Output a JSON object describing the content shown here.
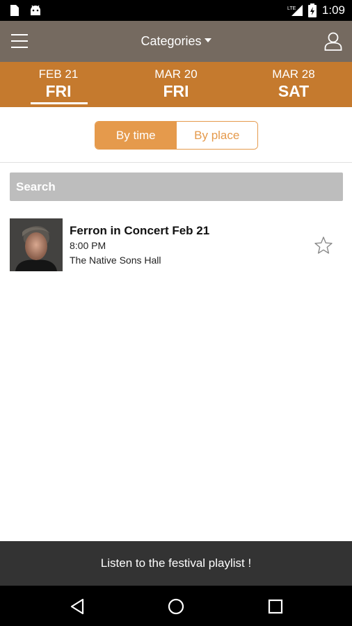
{
  "status_bar": {
    "network": "LTE",
    "time": "1:09",
    "icons": [
      "sim-card-icon",
      "android-icon",
      "lte-signal-icon",
      "battery-charging-icon"
    ]
  },
  "app_bar": {
    "categories_label": "Categories",
    "menu_icon": "hamburger-menu-icon",
    "profile_icon": "user-profile-icon"
  },
  "dates": [
    {
      "month": "FEB 21",
      "day": "FRI",
      "selected": true
    },
    {
      "month": "MAR 20",
      "day": "FRI",
      "selected": false
    },
    {
      "month": "MAR 28",
      "day": "SAT",
      "selected": false
    }
  ],
  "view_toggle": {
    "by_time": "By time",
    "by_place": "By place",
    "active": "By time"
  },
  "search": {
    "placeholder": "Search"
  },
  "events": [
    {
      "title": "Ferron in Concert Feb 21",
      "time": "8:00 PM",
      "place": "The Native Sons Hall",
      "favorited": false
    }
  ],
  "banner": {
    "text": "Listen to the festival playlist !"
  },
  "colors": {
    "app_bar": "#756a60",
    "date_bar": "#c57a2e",
    "accent": "#e59a4c",
    "search_bg": "#bdbdbd",
    "banner_bg": "#333333"
  }
}
